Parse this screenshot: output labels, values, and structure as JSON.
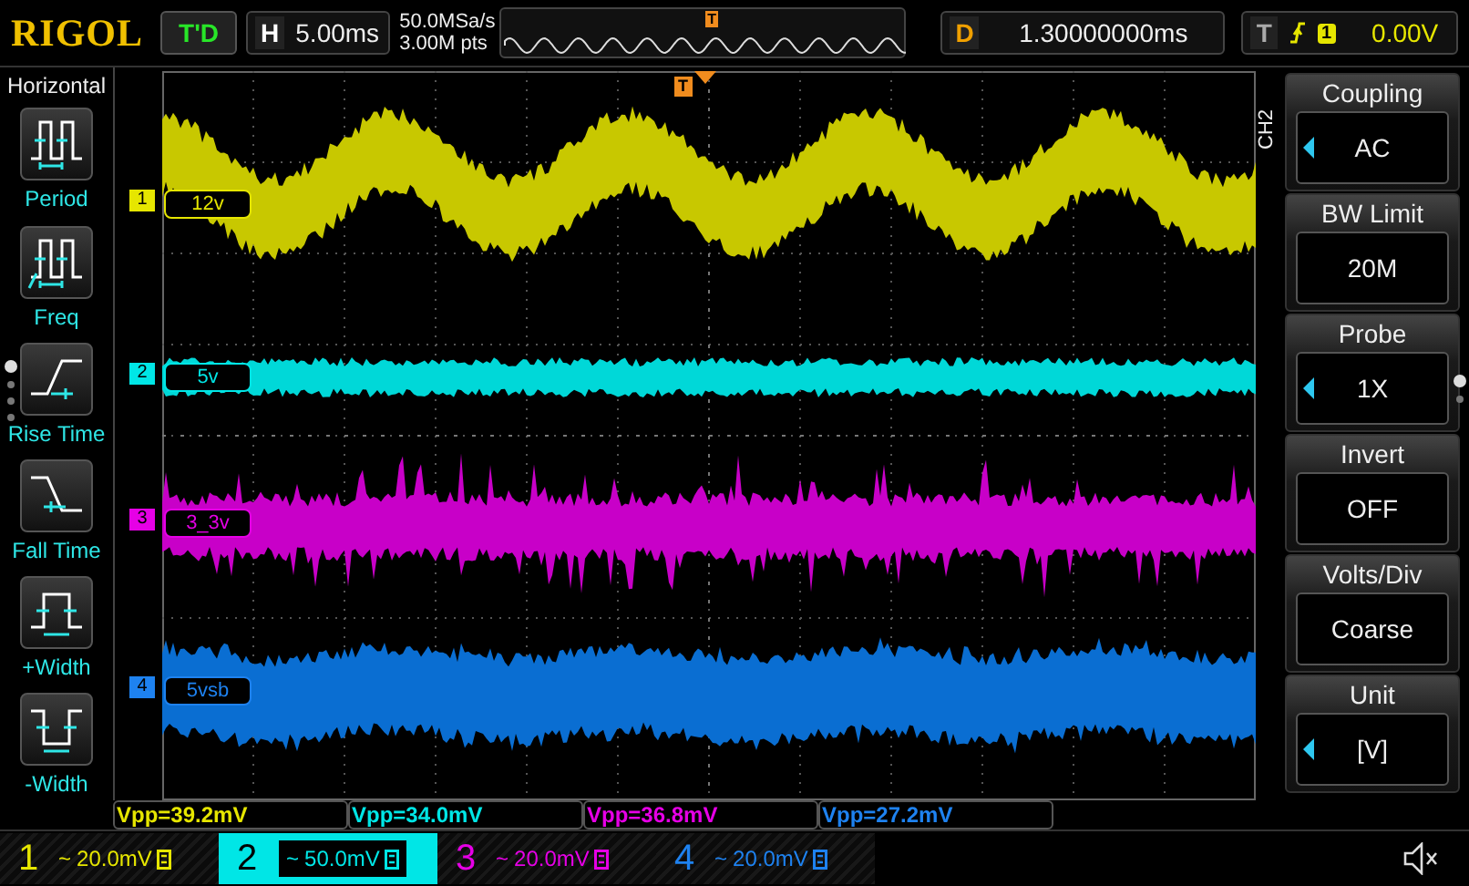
{
  "top_bar": {
    "logo": "RIGOL",
    "run_status": "T'D",
    "timebase": {
      "label": "H",
      "value": "5.00ms"
    },
    "sample_rate": "50.0MSa/s",
    "memory_depth": "3.00M pts",
    "memory_trigger_marker": "T",
    "delay": {
      "label": "D",
      "value": "1.30000000ms"
    },
    "trigger": {
      "label": "T",
      "source": "1",
      "level": "0.00V"
    }
  },
  "left_menu": {
    "title": "Horizontal",
    "items": [
      {
        "kind": "period",
        "label": "Period"
      },
      {
        "kind": "freq",
        "label": "Freq"
      },
      {
        "kind": "rise",
        "label": "Rise Time"
      },
      {
        "kind": "fall",
        "label": "Fall Time"
      },
      {
        "kind": "pwidth",
        "label": "+Width"
      },
      {
        "kind": "nwidth",
        "label": "-Width"
      }
    ]
  },
  "plot": {
    "trigger_marker": "T",
    "channels": [
      {
        "number": "1",
        "label": "12v",
        "color": "#e6e600"
      },
      {
        "number": "2",
        "label": "5v",
        "color": "#00e6e6"
      },
      {
        "number": "3",
        "label": "3_3v",
        "color": "#e600e6"
      },
      {
        "number": "4",
        "label": "5vsb",
        "color": "#1e82f0"
      }
    ]
  },
  "right_menu": {
    "tab": "CH2",
    "items": [
      {
        "title": "Coupling",
        "value": "AC",
        "arrow": true
      },
      {
        "title": "BW Limit",
        "value": "20M",
        "arrow": false
      },
      {
        "title": "Probe",
        "value": "1X",
        "arrow": true
      },
      {
        "title": "Invert",
        "value": "OFF",
        "arrow": false
      },
      {
        "title": "Volts/Div",
        "value": "Coarse",
        "arrow": false
      },
      {
        "title": "Unit",
        "value": "[V]",
        "arrow": true
      }
    ]
  },
  "measurements": [
    {
      "text": "Vpp=39.2mV"
    },
    {
      "text": "Vpp=34.0mV"
    },
    {
      "text": "Vpp=36.8mV"
    },
    {
      "text": "Vpp=27.2mV"
    }
  ],
  "channel_bar": [
    {
      "number": "1",
      "coupling": "~",
      "scale": "20.0mV",
      "selected": false,
      "color": "#e6e600"
    },
    {
      "number": "2",
      "coupling": "~",
      "scale": "50.0mV",
      "selected": true,
      "color": "#00e6e6"
    },
    {
      "number": "3",
      "coupling": "~",
      "scale": "20.0mV",
      "selected": false,
      "color": "#e600e6"
    },
    {
      "number": "4",
      "coupling": "~",
      "scale": "20.0mV",
      "selected": false,
      "color": "#1e82f0"
    }
  ]
}
